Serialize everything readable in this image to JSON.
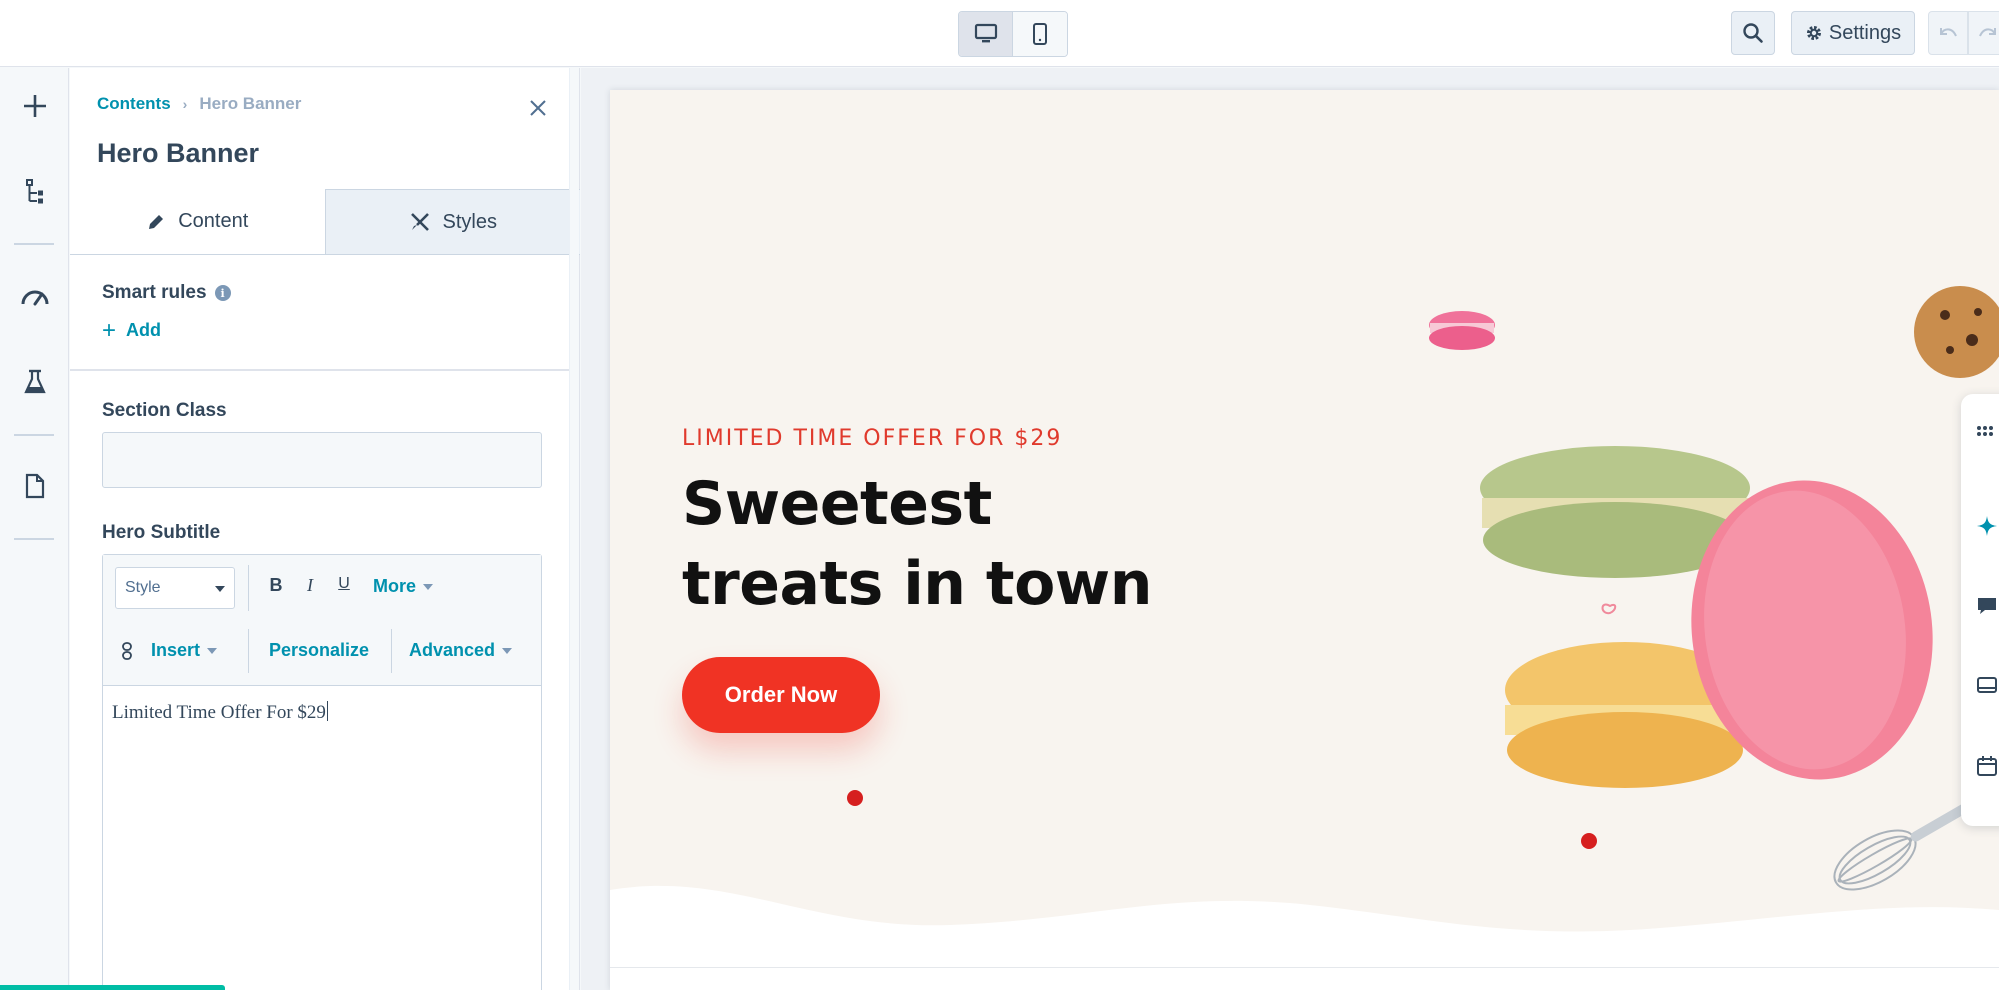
{
  "topbar": {
    "device_desktop": "desktop-icon",
    "device_mobile": "mobile-icon",
    "search_icon": "search-icon",
    "settings_label": "Settings",
    "undo_icon": "undo-icon",
    "redo_icon": "redo-icon"
  },
  "rail": {
    "items": [
      "add-icon",
      "tree-icon",
      "gauge-icon",
      "flask-icon",
      "page-icon"
    ]
  },
  "panel": {
    "breadcrumb_root": "Contents",
    "breadcrumb_current": "Hero Banner",
    "title": "Hero Banner",
    "tabs": [
      {
        "label": "Content",
        "active": true
      },
      {
        "label": "Styles",
        "active": false
      }
    ],
    "smart_rules_label": "Smart rules",
    "smart_rules_info": "i",
    "add_label": "Add",
    "section_class_label": "Section Class",
    "section_class_value": "",
    "hero_subtitle_label": "Hero Subtitle",
    "editor": {
      "style_select": "Style",
      "bold": "B",
      "italic": "I",
      "underline": "U",
      "more": "More",
      "insert": "Insert",
      "personalize": "Personalize",
      "advanced": "Advanced",
      "content": "Limited Time Offer For $29"
    }
  },
  "preview": {
    "offer_text": "LIMITED TIME OFFER FOR $29",
    "headline": "Sweetest treats in town",
    "cta_label": "Order Now"
  },
  "colors": {
    "accent_link": "#0091ae",
    "cta": "#f03324",
    "hero_bg": "#f8f4ef"
  }
}
